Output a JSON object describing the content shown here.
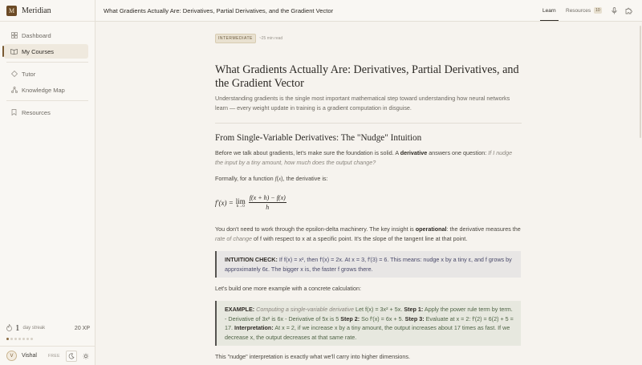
{
  "app": {
    "name": "Meridian",
    "logo_letter": "M"
  },
  "sidebar": {
    "items": [
      {
        "label": "Dashboard",
        "icon": "grid-icon"
      },
      {
        "label": "My Courses",
        "icon": "book-icon",
        "active": true
      },
      {
        "label": "Tutor",
        "icon": "sparkle-icon"
      },
      {
        "label": "Knowledge Map",
        "icon": "graph-icon"
      },
      {
        "label": "Resources",
        "icon": "bookmark-icon"
      }
    ],
    "streak": {
      "count": "1",
      "label": "day streak",
      "xp": "20 XP",
      "dots_filled": 1,
      "dots_total": 7
    },
    "user": {
      "initial": "V",
      "name": "Vishal",
      "plan": "FREE"
    }
  },
  "topbar": {
    "title": "What Gradients Actually Are: Derivatives, Partial Derivatives, and the Gradient Vector",
    "tabs": {
      "learn": "Learn",
      "resources": "Resources",
      "resources_count": "10"
    }
  },
  "article": {
    "level": "INTERMEDIATE",
    "read_time": "~25 min read",
    "title": "What Gradients Actually Are: Derivatives, Partial Derivatives, and the Gradient Vector",
    "lead": "Understanding gradients is the single most important mathematical step toward understanding how neural networks learn — every weight update in training is a gradient computation in disguise.",
    "h2": "From Single-Variable Derivatives: The \"Nudge\" Intuition",
    "p1_a": "Before we talk about gradients, let's make sure the foundation is solid. A ",
    "p1_b": "derivative",
    "p1_c": " answers one question: ",
    "p1_d": "If I nudge the input by a tiny amount, how much does the output change?",
    "p2_a": "Formally, for a function ",
    "p2_b": ", the derivative is:",
    "p3_a": "You don't need to work through the epsilon-delta machinery. The key insight is ",
    "p3_b": "operational",
    "p3_c": ": the derivative measures the ",
    "p3_d": "rate of change",
    "p3_e": " of f with respect to x at a specific point. It's the slope of the tangent line at that point.",
    "check_label": "INTUITION CHECK:",
    "check_text": " If f(x) = x², then f′(x) = 2x. At x = 3, f′(3) = 6. This means: nudge x by a tiny ε, and f grows by approximately 6ε. The bigger x is, the faster f grows there.",
    "p4": "Let's build one more example with a concrete calculation:",
    "ex_label": "EXAMPLE:",
    "ex_sub": " Computing a single-variable derivative",
    "ex_text": " Let f(x) = 3x² + 5x. ",
    "ex_s1": "Step 1:",
    "ex_t1": " Apply the power rule term by term. - Derivative of 3x² is 6x - Derivative of 5x is 5 ",
    "ex_s2": "Step 2:",
    "ex_t2": " So f′(x) = 6x + 5. ",
    "ex_s3": "Step 3:",
    "ex_t3": " Evaluate at x = 2: f′(2) = 6(2) + 5 = 17. ",
    "ex_s4": "Interpretation:",
    "ex_t4": " At x = 2, if we increase x by a tiny amount, the output increases about 17 times as fast. If we decrease x, the output decreases at that same rate.",
    "p5": "This \"nudge\" interpretation is exactly what we'll carry into higher dimensions."
  }
}
